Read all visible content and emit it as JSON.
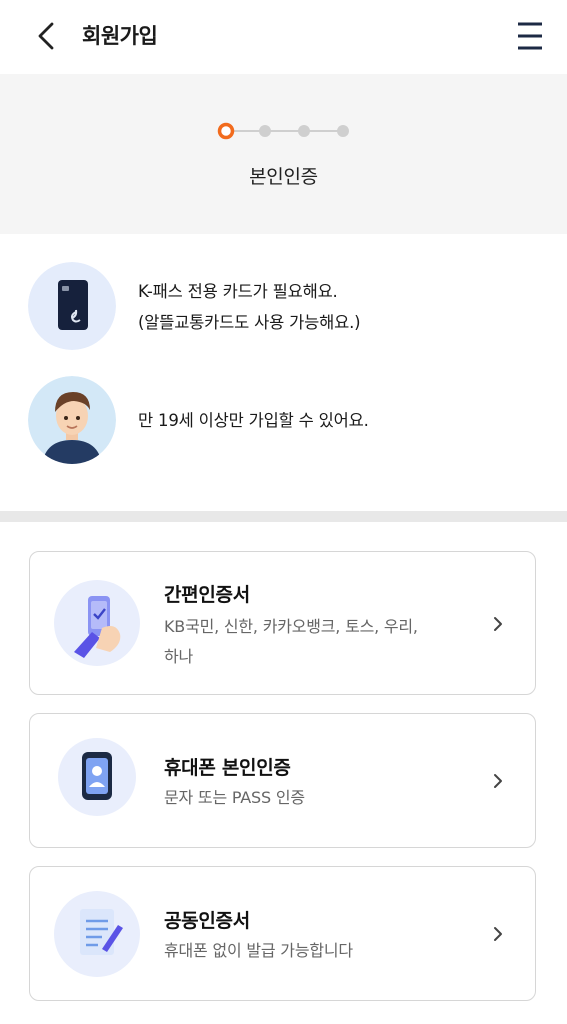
{
  "header": {
    "title": "회원가입"
  },
  "steps": {
    "current_label": "본인인증",
    "total": 4,
    "current": 1
  },
  "info": [
    {
      "line1": "K-패스 전용 카드가 필요해요.",
      "line2": "(알뜰교통카드도 사용 가능해요.)"
    },
    {
      "line1": "만 19세 이상만 가입할 수 있어요.",
      "line2": ""
    }
  ],
  "options": [
    {
      "title": "간편인증서",
      "sub1": "KB국민, 신한, 카카오뱅크, 토스, 우리,",
      "sub2": "하나"
    },
    {
      "title": "휴대폰 본인인증",
      "sub1": "문자 또는 PASS 인증",
      "sub2": ""
    },
    {
      "title": "공동인증서",
      "sub1": "휴대폰 없이 발급 가능합니다",
      "sub2": ""
    }
  ],
  "colors": {
    "accent": "#f26b1d",
    "step_inactive": "#cfcfcf",
    "navy": "#1c2a44"
  }
}
